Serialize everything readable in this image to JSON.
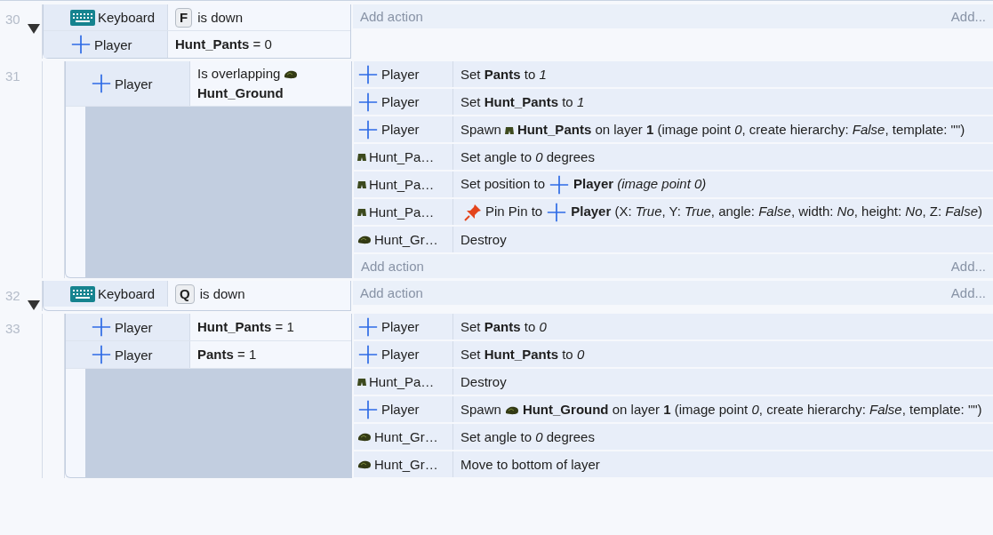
{
  "events": [
    {
      "number": "30",
      "expanded": true,
      "conditions": [
        {
          "object": "Keyboard",
          "kind": "keyboard",
          "key": "F",
          "parts": [
            {
              "kind": "text",
              "text": "is down"
            }
          ]
        },
        {
          "object": "Player",
          "kind": "sprite",
          "parts": [
            {
              "kind": "text",
              "text": "**Hunt_Pants** = 0"
            }
          ]
        }
      ],
      "add_action": {
        "label": "Add action",
        "more": "Add..."
      },
      "children": [
        {
          "number": "31",
          "conditions": [
            {
              "object": "Player",
              "kind": "sprite",
              "parts": [
                {
                  "kind": "text",
                  "text": "Is overlapping"
                },
                {
                  "kind": "ground"
                },
                {
                  "kind": "text",
                  "text": "**Hunt_Ground**"
                }
              ]
            }
          ],
          "actions": [
            {
              "object": "Player",
              "kind": "sprite",
              "parts": [
                {
                  "kind": "text",
                  "text": "Set **Pants** to *1*"
                }
              ]
            },
            {
              "object": "Player",
              "kind": "sprite",
              "parts": [
                {
                  "kind": "text",
                  "text": "Set **Hunt_Pants** to *1*"
                }
              ]
            },
            {
              "object": "Player",
              "kind": "sprite",
              "parts": [
                {
                  "kind": "text",
                  "text": "Spawn"
                },
                {
                  "kind": "pants"
                },
                {
                  "kind": "text",
                  "text": "**Hunt_Pants** on layer **1** (image point *0*, create hierarchy: *False*, template: \"\")"
                }
              ]
            },
            {
              "object": "Hunt_Pa…",
              "kind": "pants",
              "parts": [
                {
                  "kind": "text",
                  "text": "Set angle to *0* degrees"
                }
              ]
            },
            {
              "object": "Hunt_Pa…",
              "kind": "pants",
              "parts": [
                {
                  "kind": "text",
                  "text": "Set position to"
                },
                {
                  "kind": "sprite"
                },
                {
                  "kind": "text",
                  "text": "**Player** *(image point 0)*"
                }
              ]
            },
            {
              "object": "Hunt_Pa…",
              "kind": "pants",
              "parts": [
                {
                  "kind": "pin"
                },
                {
                  "kind": "text",
                  "text": "Pin Pin to"
                },
                {
                  "kind": "sprite"
                },
                {
                  "kind": "text",
                  "text": "**Player** (X: *True*, Y: *True*, angle: *False*, width: *No*, height: *No*, Z: *False*)"
                }
              ]
            },
            {
              "object": "Hunt_Gr…",
              "kind": "ground",
              "parts": [
                {
                  "kind": "text",
                  "text": "Destroy"
                }
              ]
            }
          ],
          "add_action": {
            "label": "Add action",
            "more": "Add..."
          }
        }
      ]
    },
    {
      "number": "32",
      "expanded": true,
      "conditions": [
        {
          "object": "Keyboard",
          "kind": "keyboard",
          "key": "Q",
          "parts": [
            {
              "kind": "text",
              "text": "is down"
            }
          ]
        }
      ],
      "add_action": {
        "label": "Add action",
        "more": "Add..."
      },
      "children": [
        {
          "number": "33",
          "conditions": [
            {
              "object": "Player",
              "kind": "sprite",
              "parts": [
                {
                  "kind": "text",
                  "text": "**Hunt_Pants** = 1"
                }
              ]
            },
            {
              "object": "Player",
              "kind": "sprite",
              "parts": [
                {
                  "kind": "text",
                  "text": "**Pants** = 1"
                }
              ]
            }
          ],
          "actions": [
            {
              "object": "Player",
              "kind": "sprite",
              "parts": [
                {
                  "kind": "text",
                  "text": "Set **Pants** to *0*"
                }
              ]
            },
            {
              "object": "Player",
              "kind": "sprite",
              "parts": [
                {
                  "kind": "text",
                  "text": "Set **Hunt_Pants** to *0*"
                }
              ]
            },
            {
              "object": "Hunt_Pa…",
              "kind": "pants",
              "parts": [
                {
                  "kind": "text",
                  "text": "Destroy"
                }
              ]
            },
            {
              "object": "Player",
              "kind": "sprite",
              "parts": [
                {
                  "kind": "text",
                  "text": "Spawn"
                },
                {
                  "kind": "ground"
                },
                {
                  "kind": "text",
                  "text": "**Hunt_Ground** on layer **1** (image point *0*, create hierarchy: *False*, template: \"\")"
                }
              ]
            },
            {
              "object": "Hunt_Gr…",
              "kind": "ground",
              "parts": [
                {
                  "kind": "text",
                  "text": "Set angle to *0* degrees"
                }
              ]
            },
            {
              "object": "Hunt_Gr…",
              "kind": "ground",
              "parts": [
                {
                  "kind": "text",
                  "text": "Move to bottom of layer"
                }
              ]
            }
          ]
        }
      ]
    }
  ]
}
